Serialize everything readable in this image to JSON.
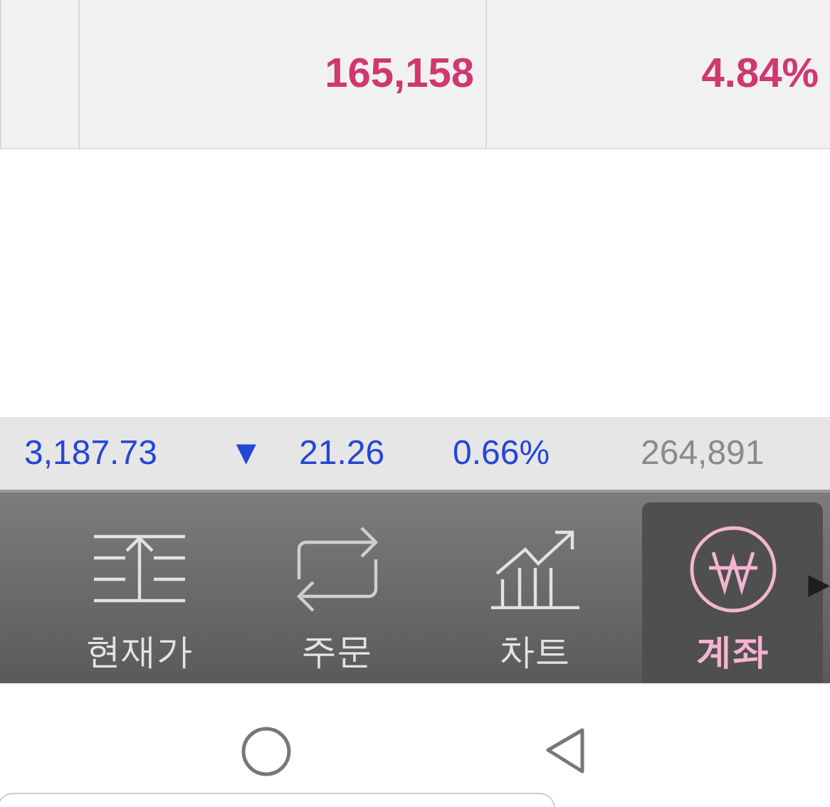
{
  "quote_row": {
    "cells": [
      "165,158",
      "4.84%"
    ],
    "kind": "up"
  },
  "index_bar": {
    "value": "3,187.73",
    "arrow": "▼",
    "change": "21.26",
    "rate": "0.66%",
    "volume": "264,891",
    "kind": "down"
  },
  "tab_bar": {
    "tabs": [
      {
        "label": "현재가",
        "kind": "price",
        "selected": false
      },
      {
        "label": "주문",
        "kind": "order",
        "selected": false
      },
      {
        "label": "차트",
        "kind": "chart",
        "selected": false
      },
      {
        "label": "계좌",
        "kind": "account",
        "selected": true
      }
    ],
    "more": "▶"
  },
  "system_nav": {
    "buttons": [
      {
        "kind": "home"
      },
      {
        "kind": "back"
      }
    ]
  }
}
